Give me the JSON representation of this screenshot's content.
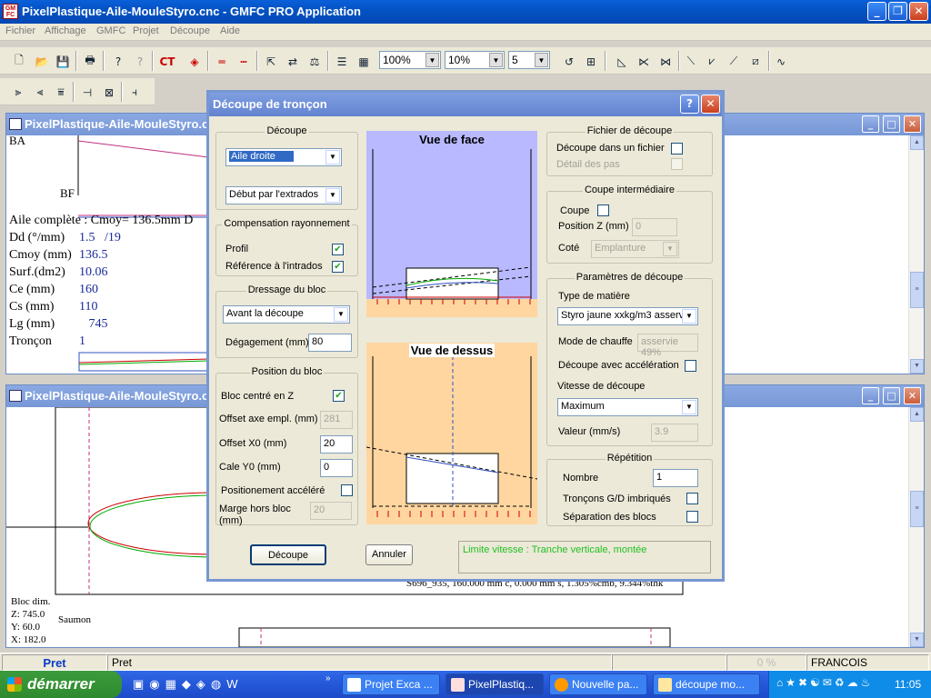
{
  "app": {
    "title": "PixelPlastique-Aile-MouleStyro.cnc - GMFC PRO Application",
    "icon_text": "GM FC",
    "menu": [
      "Fichier",
      "Affichage",
      "GMFC",
      "Projet",
      "Découpe",
      "Aide"
    ],
    "toolbar_icons": [
      "new-file-icon",
      "open-folder-icon",
      "save-icon",
      "print-icon",
      "help-icon",
      "context-help-icon",
      "ct-icon",
      "target-icon",
      "line-red-icon",
      "line-dashed-icon",
      "import-icon",
      "swap-icon",
      "balance-icon",
      "layers-icon",
      "grid-icon"
    ],
    "zoom": "100%",
    "step": "10%",
    "count": "5"
  },
  "mdi1": {
    "title": "PixelPlastique-Aile-MouleStyro.c",
    "ba": "BA",
    "bf": "BF",
    "stats_header": "Aile complète : Cmoy= 136.5mm D",
    "stats": [
      {
        "label": "Dd (°/mm)",
        "value": "1.5   /19"
      },
      {
        "label": "Cmoy (mm)",
        "value": "136.5"
      },
      {
        "label": "Surf.(dm2)",
        "value": "10.06"
      },
      {
        "label": "Ce (mm)",
        "value": "160"
      },
      {
        "label": "Cs (mm)",
        "value": "110"
      },
      {
        "label": "Lg (mm)",
        "value": "   745"
      },
      {
        "label": "Tronçon",
        "value": "1"
      }
    ]
  },
  "mdi2": {
    "title": "PixelPlastique-Aile-MouleStyro.c",
    "section_label": "S696_935, 160.000 mm c, 0.000 mm s, 1.305%cmb, 9.344%thk",
    "bloc_dim": "Bloc dim.",
    "z": "Z: 745.0",
    "y": "Y: 60.0",
    "x": "X: 182.0",
    "saumon": "Saumon"
  },
  "dialog": {
    "title": "Découpe de tronçon",
    "decoupe": {
      "legend": "Découpe",
      "aile": "Aile droite",
      "debut": "Début par l'extrados"
    },
    "compensation": {
      "legend": "Compensation rayonnement",
      "profil": "Profil",
      "ref": "Référence à l'intrados"
    },
    "dressage": {
      "legend": "Dressage du bloc",
      "mode": "Avant la découpe",
      "degagement_label": "Dégagement (mm)",
      "degagement": "80"
    },
    "position": {
      "legend": "Position du bloc",
      "centre": "Bloc centré en Z",
      "offset_axe_label": "Offset axe empl. (mm)",
      "offset_axe": "281",
      "offset_x0_label": "Offset X0 (mm)",
      "offset_x0": "20",
      "cale_y0_label": "Cale Y0 (mm)",
      "cale_y0": "0",
      "accelere": "Positionement accéléré",
      "marge_label_1": "Marge hors bloc",
      "marge_label_2": "(mm)",
      "marge": "20"
    },
    "vue_face": "Vue de face",
    "vue_dessus": "Vue de dessus",
    "fichier": {
      "legend": "Fichier de découpe",
      "dans_fichier": "Découpe dans un fichier",
      "detail": "Détail des pas"
    },
    "coupe": {
      "legend": "Coupe intermédiaire",
      "coupe": "Coupe",
      "posz_label": "Position Z (mm)",
      "posz": "0",
      "cote_label": "Coté",
      "cote": "Emplanture"
    },
    "params": {
      "legend": "Paramètres de découpe",
      "matiere_label": "Type de matière",
      "matiere": "Styro jaune xxkg/m3 asserv",
      "chauffe_label": "Mode de chauffe",
      "chauffe": "asservie 49%",
      "acceleration": "Découpe avec accélération",
      "vitesse_label": "Vitesse de découpe",
      "vitesse": "Maximum",
      "valeur_label": "Valeur (mm/s)",
      "valeur": "3.9"
    },
    "repetition": {
      "legend": "Répétition",
      "nombre_label": "Nombre",
      "nombre": "1",
      "imbriques": "Tronçons G/D imbriqués",
      "separation": "Séparation des blocs"
    },
    "btn_decoupe": "Découpe",
    "btn_annuler": "Annuler",
    "message": "Limite vitesse : Tranche verticale, montée"
  },
  "status": {
    "left": "Pret",
    "main": "Pret",
    "progress": "0 %",
    "user": "FRANCOIS"
  },
  "taskbar": {
    "start": "démarrer",
    "tasks": [
      "Projet Exca ...",
      "PixelPlastiq...",
      "Nouvelle pa...",
      "découpe mo..."
    ],
    "clock": "11:05"
  }
}
